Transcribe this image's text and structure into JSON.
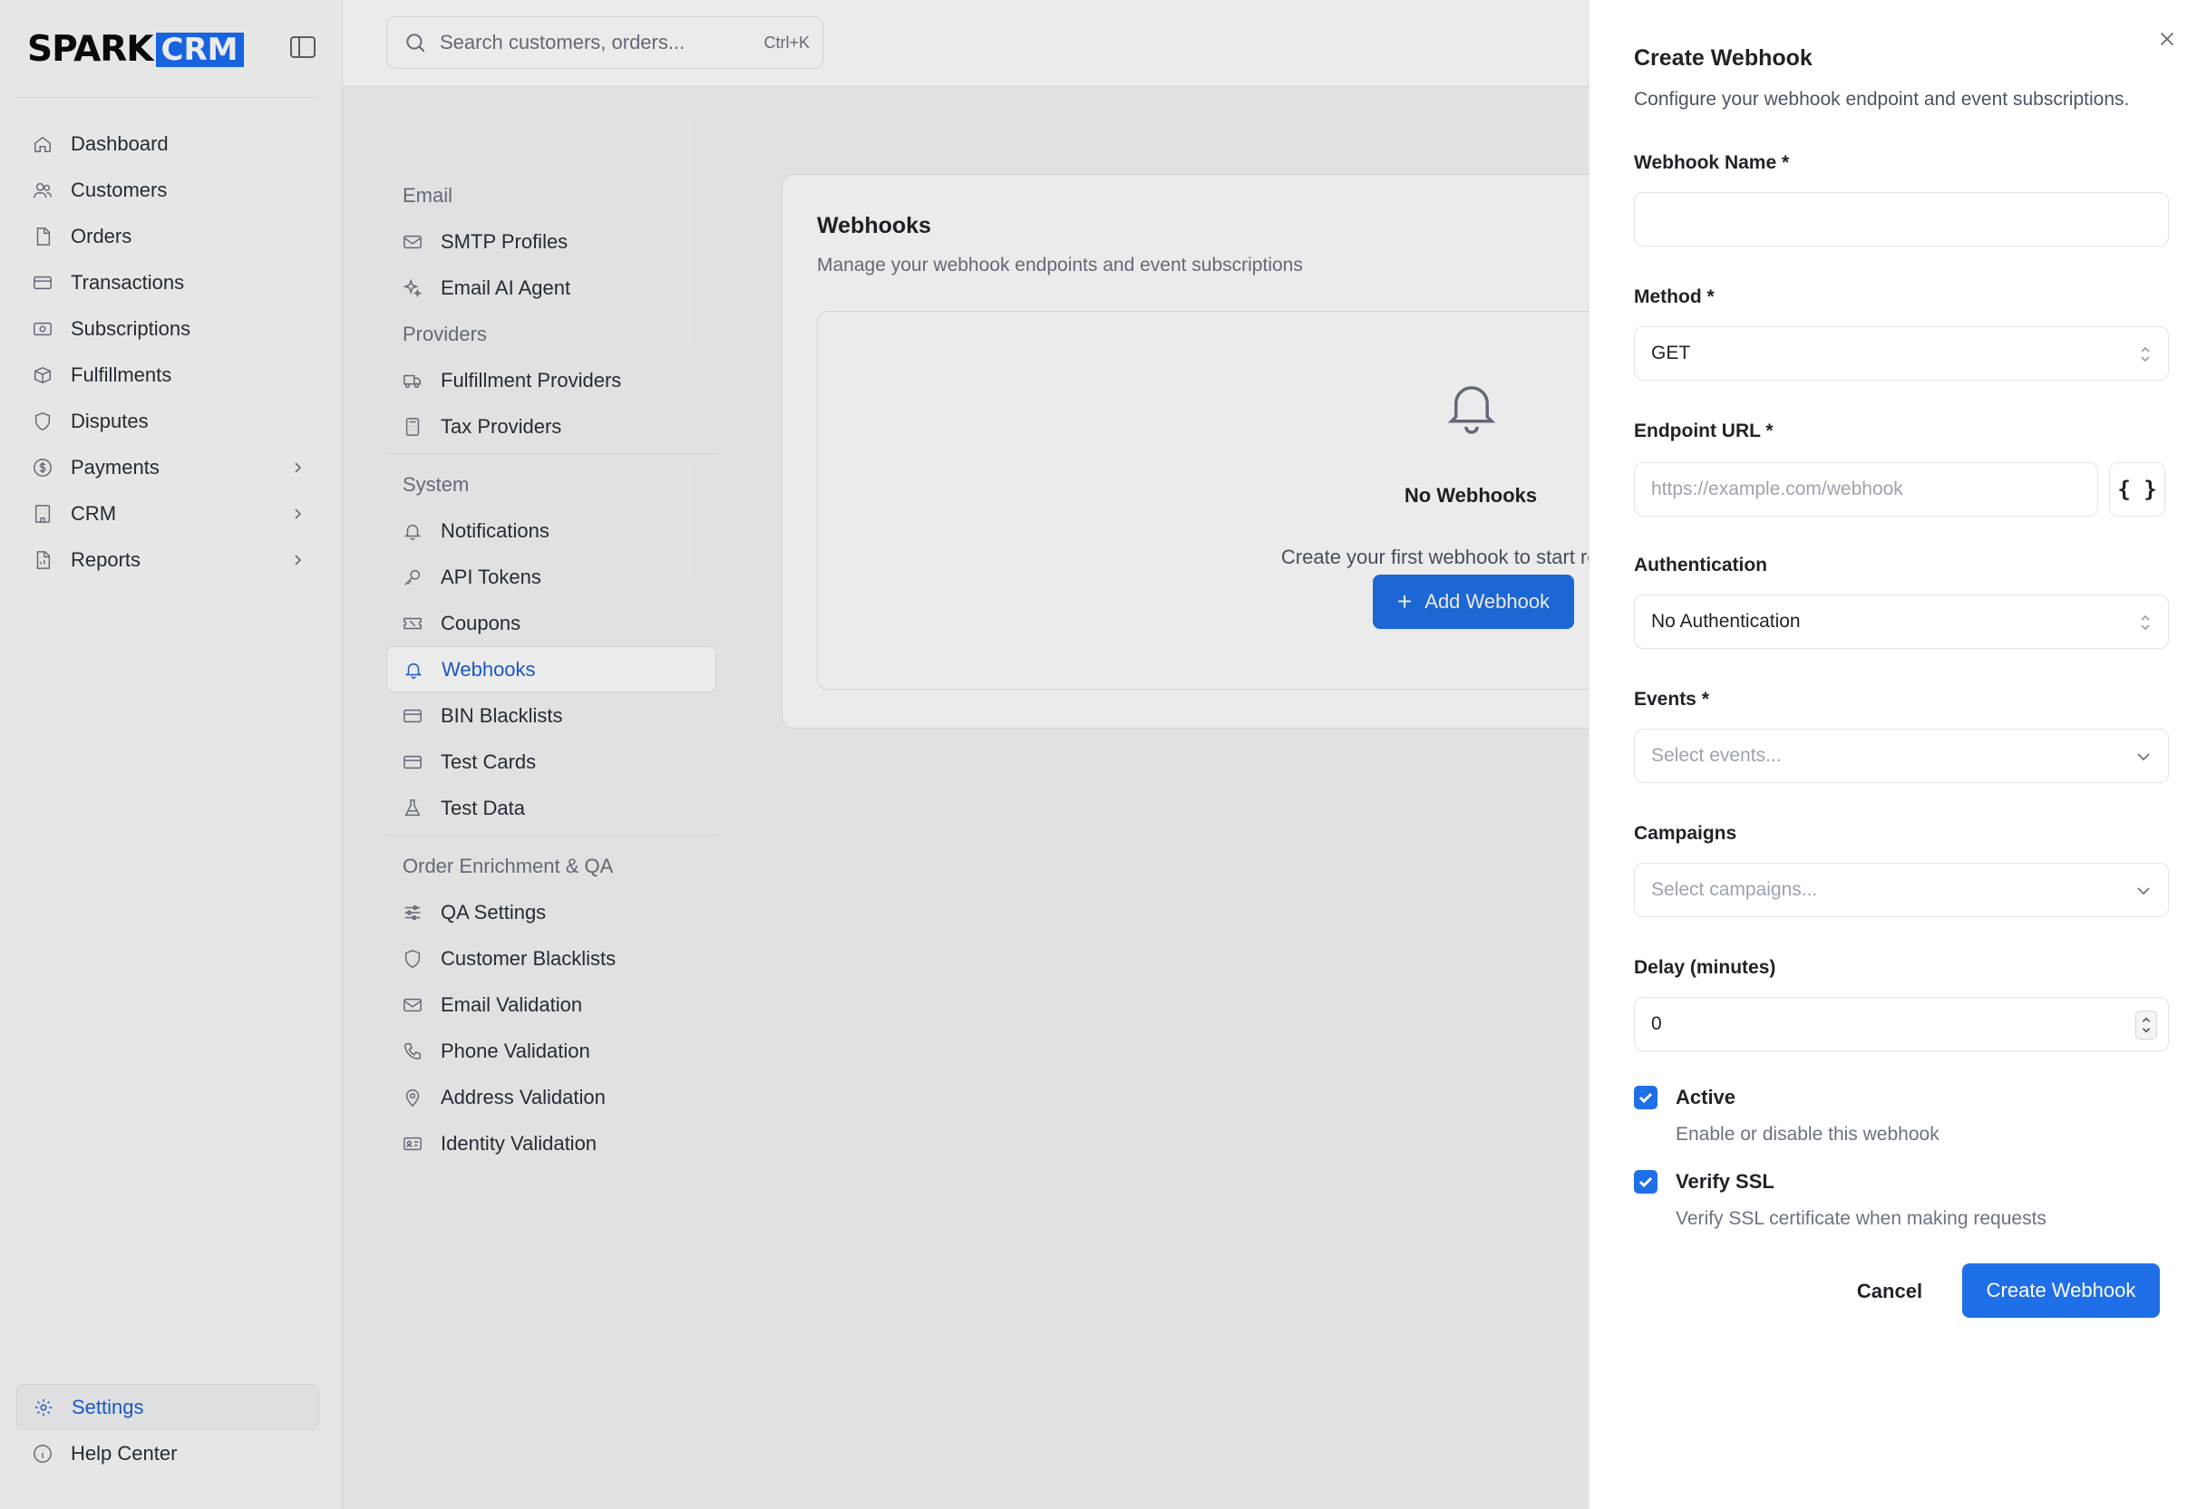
{
  "brand": {
    "part1": "SPARK",
    "part2": "CRM",
    "accent": "#1b6cf2"
  },
  "sidebar": {
    "items": [
      {
        "label": "Dashboard",
        "icon": "home-icon"
      },
      {
        "label": "Customers",
        "icon": "users-icon"
      },
      {
        "label": "Orders",
        "icon": "file-icon"
      },
      {
        "label": "Transactions",
        "icon": "credit-card-icon"
      },
      {
        "label": "Subscriptions",
        "icon": "subscription-icon"
      },
      {
        "label": "Fulfillments",
        "icon": "box-icon"
      },
      {
        "label": "Disputes",
        "icon": "shield-icon"
      },
      {
        "label": "Payments",
        "icon": "dollar-icon",
        "expandable": true
      },
      {
        "label": "CRM",
        "icon": "building-icon",
        "expandable": true
      },
      {
        "label": "Reports",
        "icon": "report-icon",
        "expandable": true
      }
    ],
    "bottom": [
      {
        "label": "Settings",
        "icon": "gear-icon",
        "active": true
      },
      {
        "label": "Help Center",
        "icon": "info-icon"
      }
    ]
  },
  "search": {
    "placeholder": "Search customers, orders...",
    "shortcut": "Ctrl+K"
  },
  "settings_nav": {
    "email_section": "Email",
    "smtp": "SMTP Profiles",
    "email_ai": "Email AI Agent",
    "providers_section": "Providers",
    "fulfillment_providers": "Fulfillment Providers",
    "tax_providers": "Tax Providers",
    "system_section": "System",
    "notifications": "Notifications",
    "api_tokens": "API Tokens",
    "coupons": "Coupons",
    "webhooks": "Webhooks",
    "bin_blacklists": "BIN Blacklists",
    "test_cards": "Test Cards",
    "test_data": "Test Data",
    "qa_section": "Order Enrichment & QA",
    "qa_settings": "QA Settings",
    "customer_blacklists": "Customer Blacklists",
    "email_validation": "Email Validation",
    "phone_validation": "Phone Validation",
    "address_validation": "Address Validation",
    "identity_validation": "Identity Validation"
  },
  "webhooks_card": {
    "title": "Webhooks",
    "subtitle": "Manage your webhook endpoints and event subscriptions",
    "empty_title": "No Webhooks",
    "empty_desc": "Create your first webhook to start receiving",
    "add_button": "Add Webhook"
  },
  "panel": {
    "title": "Create Webhook",
    "subtitle": "Configure your webhook endpoint and event subscriptions.",
    "name_label": "Webhook Name *",
    "name_value": "",
    "method_label": "Method *",
    "method_value": "GET",
    "url_label": "Endpoint URL *",
    "url_placeholder": "https://example.com/webhook",
    "braces": "{ }",
    "auth_label": "Authentication",
    "auth_value": "No Authentication",
    "events_label": "Events *",
    "events_placeholder": "Select events...",
    "campaigns_label": "Campaigns",
    "campaigns_placeholder": "Select campaigns...",
    "delay_label": "Delay (minutes)",
    "delay_value": "0",
    "active_label": "Active",
    "active_desc": "Enable or disable this webhook",
    "ssl_label": "Verify SSL",
    "ssl_desc": "Verify SSL certificate when making requests",
    "cancel": "Cancel",
    "create": "Create Webhook",
    "primary_color": "#1f6fe8"
  }
}
